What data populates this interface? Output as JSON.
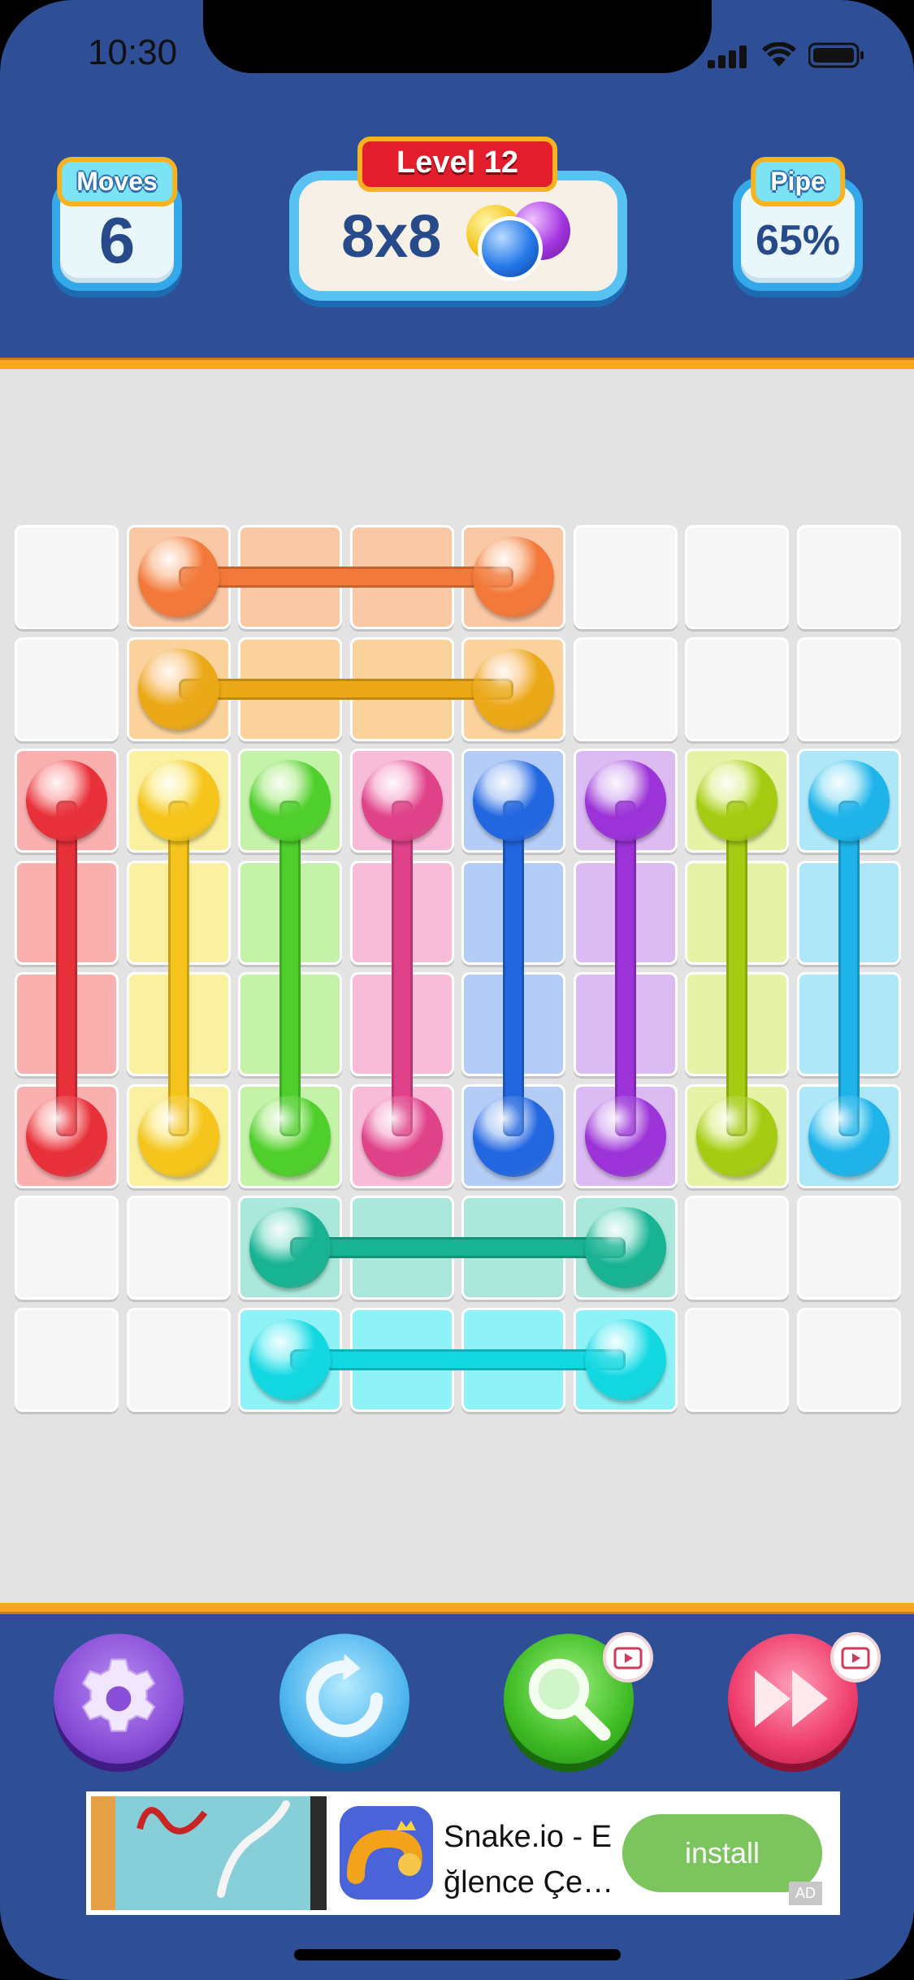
{
  "status_bar": {
    "time": "10:30"
  },
  "header": {
    "moves": {
      "label": "Moves",
      "value": "6"
    },
    "level": {
      "label": "Level 12",
      "grid": "8x8"
    },
    "pipe": {
      "label": "Pipe",
      "value": "65%"
    }
  },
  "board": {
    "rows": 8,
    "cols": 8,
    "pipes": [
      {
        "color": "orange-red",
        "hex": "#f2793a",
        "light": "#fbc8a6",
        "from": [
          0,
          1
        ],
        "to": [
          0,
          4
        ]
      },
      {
        "color": "amber",
        "hex": "#eba817",
        "light": "#fbd29c",
        "from": [
          1,
          1
        ],
        "to": [
          1,
          4
        ]
      },
      {
        "color": "red",
        "hex": "#e8303a",
        "light": "#fbb0b0",
        "from": [
          2,
          0
        ],
        "to": [
          5,
          0
        ]
      },
      {
        "color": "yellow",
        "hex": "#f5c51b",
        "light": "#fbf0a0",
        "from": [
          2,
          1
        ],
        "to": [
          5,
          1
        ]
      },
      {
        "color": "green",
        "hex": "#4fcf2b",
        "light": "#c4f2a8",
        "from": [
          2,
          2
        ],
        "to": [
          5,
          2
        ]
      },
      {
        "color": "pink",
        "hex": "#e0428a",
        "light": "#f9bcd8",
        "from": [
          2,
          3
        ],
        "to": [
          5,
          3
        ]
      },
      {
        "color": "blue",
        "hex": "#2266e0",
        "light": "#b4cdf6",
        "from": [
          2,
          4
        ],
        "to": [
          5,
          4
        ]
      },
      {
        "color": "purple",
        "hex": "#9b33d8",
        "light": "#dcbaf2",
        "from": [
          2,
          5
        ],
        "to": [
          5,
          5
        ]
      },
      {
        "color": "lime",
        "hex": "#a5cc12",
        "light": "#e6f3a6",
        "from": [
          2,
          6
        ],
        "to": [
          5,
          6
        ]
      },
      {
        "color": "sky",
        "hex": "#1eb4ea",
        "light": "#aee8f8",
        "from": [
          2,
          7
        ],
        "to": [
          5,
          7
        ]
      },
      {
        "color": "teal",
        "hex": "#18b393",
        "light": "#a9e8da",
        "from": [
          6,
          2
        ],
        "to": [
          6,
          5
        ]
      },
      {
        "color": "cyan",
        "hex": "#13d8e2",
        "light": "#8ff2f6",
        "from": [
          7,
          2
        ],
        "to": [
          7,
          5
        ]
      }
    ]
  },
  "controls": [
    {
      "name": "settings-button",
      "icon": "gear-icon"
    },
    {
      "name": "undo-button",
      "icon": "refresh-icon"
    },
    {
      "name": "hint-button",
      "icon": "magnifier-icon",
      "video": true
    },
    {
      "name": "skip-button",
      "icon": "fast-forward-icon",
      "video": true
    }
  ],
  "ad": {
    "title_line1": "Snake.io - E",
    "title_line2": "ğlence Çe…",
    "install_label": "install",
    "badge": "AD"
  }
}
